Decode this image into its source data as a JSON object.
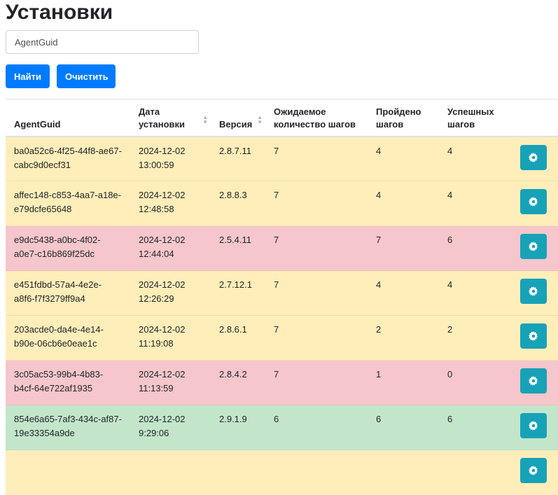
{
  "page": {
    "title": "Установки"
  },
  "search": {
    "placeholder": "AgentGuid"
  },
  "buttons": {
    "find": "Найти",
    "clear": "Очистить"
  },
  "columns": [
    {
      "key": "agent_guid",
      "label": "AgentGuid",
      "sortable": false
    },
    {
      "key": "install_date",
      "label": "Дата установки",
      "sortable": true
    },
    {
      "key": "version",
      "label": "Версия",
      "sortable": true
    },
    {
      "key": "expected_steps",
      "label": "Ожидаемое количество шагов",
      "sortable": false
    },
    {
      "key": "steps_done",
      "label": "Пройдено шагов",
      "sortable": false
    },
    {
      "key": "steps_ok",
      "label": "Успешных шагов",
      "sortable": false
    }
  ],
  "rows": [
    {
      "status": "warning",
      "agent_guid": "ba0a52c6-4f25-44f8-ae67-cabc9d0ecf31",
      "date": "2024-12-02",
      "time": "13:00:59",
      "version": "2.8.7.11",
      "expected_steps": "7",
      "steps_done": "4",
      "steps_ok": "4"
    },
    {
      "status": "warning",
      "agent_guid": "affec148-c853-4aa7-a18e-e79dcfe65648",
      "date": "2024-12-02",
      "time": "12:48:58",
      "version": "2.8.8.3",
      "expected_steps": "7",
      "steps_done": "4",
      "steps_ok": "4"
    },
    {
      "status": "danger",
      "agent_guid": "e9dc5438-a0bc-4f02-a0e7-c16b869f25dc",
      "date": "2024-12-02",
      "time": "12:44:04",
      "version": "2.5.4.11",
      "expected_steps": "7",
      "steps_done": "7",
      "steps_ok": "6"
    },
    {
      "status": "warning",
      "agent_guid": "e451fdbd-57a4-4e2e-a8f6-f7f3279ff9a4",
      "date": "2024-12-02",
      "time": "12:26:29",
      "version": "2.7.12.1",
      "expected_steps": "7",
      "steps_done": "4",
      "steps_ok": "4"
    },
    {
      "status": "warning",
      "agent_guid": "203acde0-da4e-4e14-b90e-06cb6e0eae1c",
      "date": "2024-12-02",
      "time": "11:19:08",
      "version": "2.8.6.1",
      "expected_steps": "7",
      "steps_done": "2",
      "steps_ok": "2"
    },
    {
      "status": "danger",
      "agent_guid": "3c05ac53-99b4-4b83-b4cf-64e722af1935",
      "date": "2024-12-02",
      "time": "11:13:59",
      "version": "2.8.4.2",
      "expected_steps": "7",
      "steps_done": "1",
      "steps_ok": "0"
    },
    {
      "status": "success",
      "agent_guid": "854e6a65-7af3-434c-af87-19e33354a9de",
      "date": "2024-12-02",
      "time": "9:29:06",
      "version": "2.9.1.9",
      "expected_steps": "6",
      "steps_done": "6",
      "steps_ok": "6"
    },
    {
      "status": "warning",
      "agent_guid": "",
      "date": "",
      "time": "",
      "version": "",
      "expected_steps": "",
      "steps_done": "",
      "steps_ok": ""
    }
  ],
  "row_action_icon": "gear-icon",
  "colors": {
    "primary": "#007bff",
    "info": "#17a2b8",
    "warning": "#ffeeba",
    "danger": "#f5c6cb",
    "success": "#c3e6cb"
  }
}
